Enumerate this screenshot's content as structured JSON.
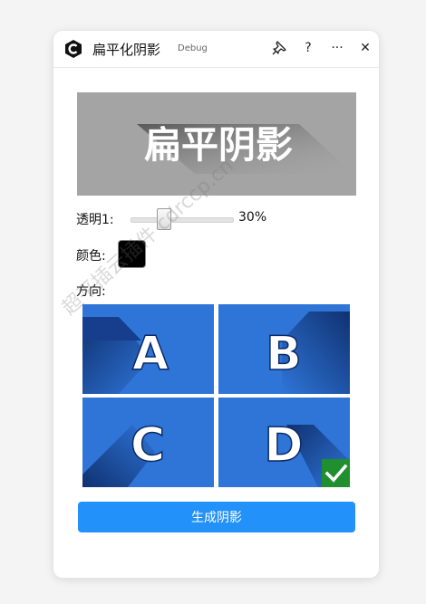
{
  "titlebar": {
    "title": "扁平化阴影",
    "debug_label": "Debug",
    "icons": [
      "pin-icon",
      "help-icon",
      "more-icon",
      "close-icon"
    ],
    "help_glyph": "?",
    "more_glyph": "···",
    "close_glyph": "✕"
  },
  "preview": {
    "text": "扁平阴影",
    "background": "#a4a4a4"
  },
  "opacity": {
    "label": "透明1:",
    "value": "30%",
    "fraction": 0.3
  },
  "color": {
    "label": "颜色:",
    "value": "#000000"
  },
  "direction": {
    "label": "方向:",
    "options": [
      {
        "letter": "A",
        "selected": false
      },
      {
        "letter": "B",
        "selected": false
      },
      {
        "letter": "C",
        "selected": false
      },
      {
        "letter": "D",
        "selected": true
      }
    ],
    "tile_color": "#2f75d8",
    "check_color": "#1f8f2f"
  },
  "generate_button": {
    "label": "生成阴影",
    "color": "#2291fa"
  },
  "watermark": "超平插云插件 cdrccp.cn"
}
